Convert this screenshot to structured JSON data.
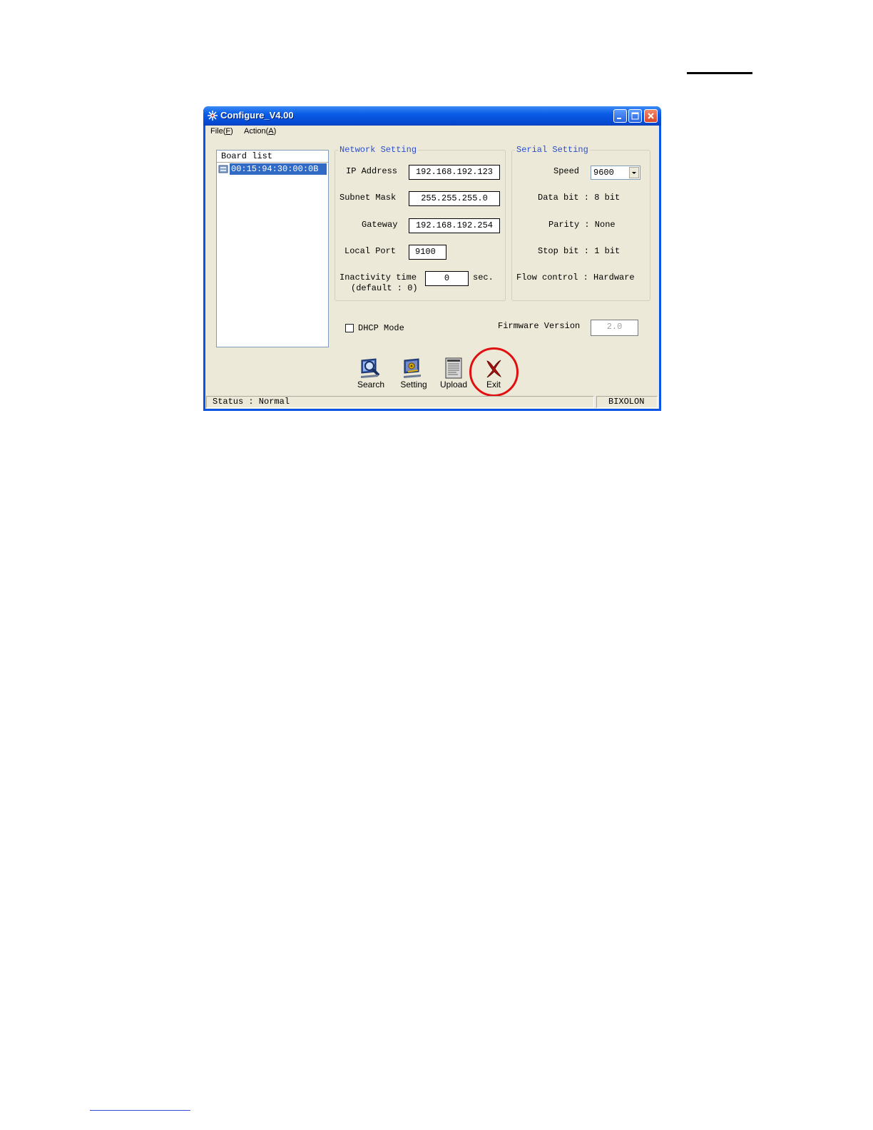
{
  "window": {
    "title": "Configure_V4.00"
  },
  "menu": {
    "file_label": "File(",
    "file_key": "F",
    "action_label": "Action(",
    "action_key": "A",
    "close_paren": ")"
  },
  "board_list": {
    "header": "Board list",
    "items": [
      "00:15:94:30:00:0B"
    ]
  },
  "network_setting": {
    "title": "Network Setting",
    "ip_label": "IP Address",
    "ip_value": "192.168.192.123",
    "subnet_label": "Subnet Mask",
    "subnet_value": "255.255.255.0",
    "gateway_label": "Gateway",
    "gateway_value": "192.168.192.254",
    "port_label": "Local Port",
    "port_value": "9100",
    "inactivity_label": "Inactivity time",
    "inactivity_default": "(default : 0)",
    "inactivity_value": "0",
    "inactivity_unit": "sec."
  },
  "serial_setting": {
    "title": "Serial Setting",
    "speed_label": "Speed",
    "speed_value": "9600",
    "data_bit": "Data bit : 8 bit",
    "parity": "Parity : None",
    "stop_bit": "Stop bit : 1 bit",
    "flow_control": "Flow control : Hardware"
  },
  "dhcp": {
    "label": "DHCP Mode",
    "checked": false
  },
  "firmware": {
    "label": "Firmware Version",
    "value": "2.0"
  },
  "toolbar": {
    "search": "Search",
    "setting": "Setting",
    "upload": "Upload",
    "exit": "Exit"
  },
  "status": {
    "text": "Status : Normal",
    "brand": "BIXOLON"
  },
  "colors": {
    "title_bar": "#0a54e6",
    "selection": "#316ac5",
    "group_title": "#2a4ed0",
    "highlight_ring": "#e01010"
  }
}
